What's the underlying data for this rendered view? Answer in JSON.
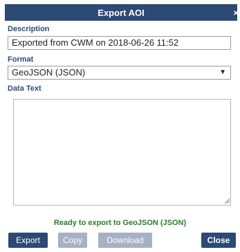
{
  "dialog": {
    "title": "Export AOI",
    "close_glyph": "×"
  },
  "description": {
    "label": "Description",
    "value": "Exported from CWM on 2018-06-26 11:52"
  },
  "format": {
    "label": "Format",
    "selected": "GeoJSON (JSON)",
    "arrow_glyph": "▼"
  },
  "data_text": {
    "label": "Data Text",
    "value": ""
  },
  "status": {
    "text": "Ready to export to GeoJSON (JSON)",
    "color": "#2b7a2b"
  },
  "buttons": {
    "export": "Export",
    "copy": "Copy",
    "download": "Download",
    "close": "Close"
  },
  "colors": {
    "primary": "#2d4a75",
    "disabled": "#a6b2c4",
    "label": "#2d4a75"
  },
  "icons": {
    "close": "close-icon",
    "dropdown": "chevron-down-icon",
    "resize": "resize-grip-icon"
  }
}
